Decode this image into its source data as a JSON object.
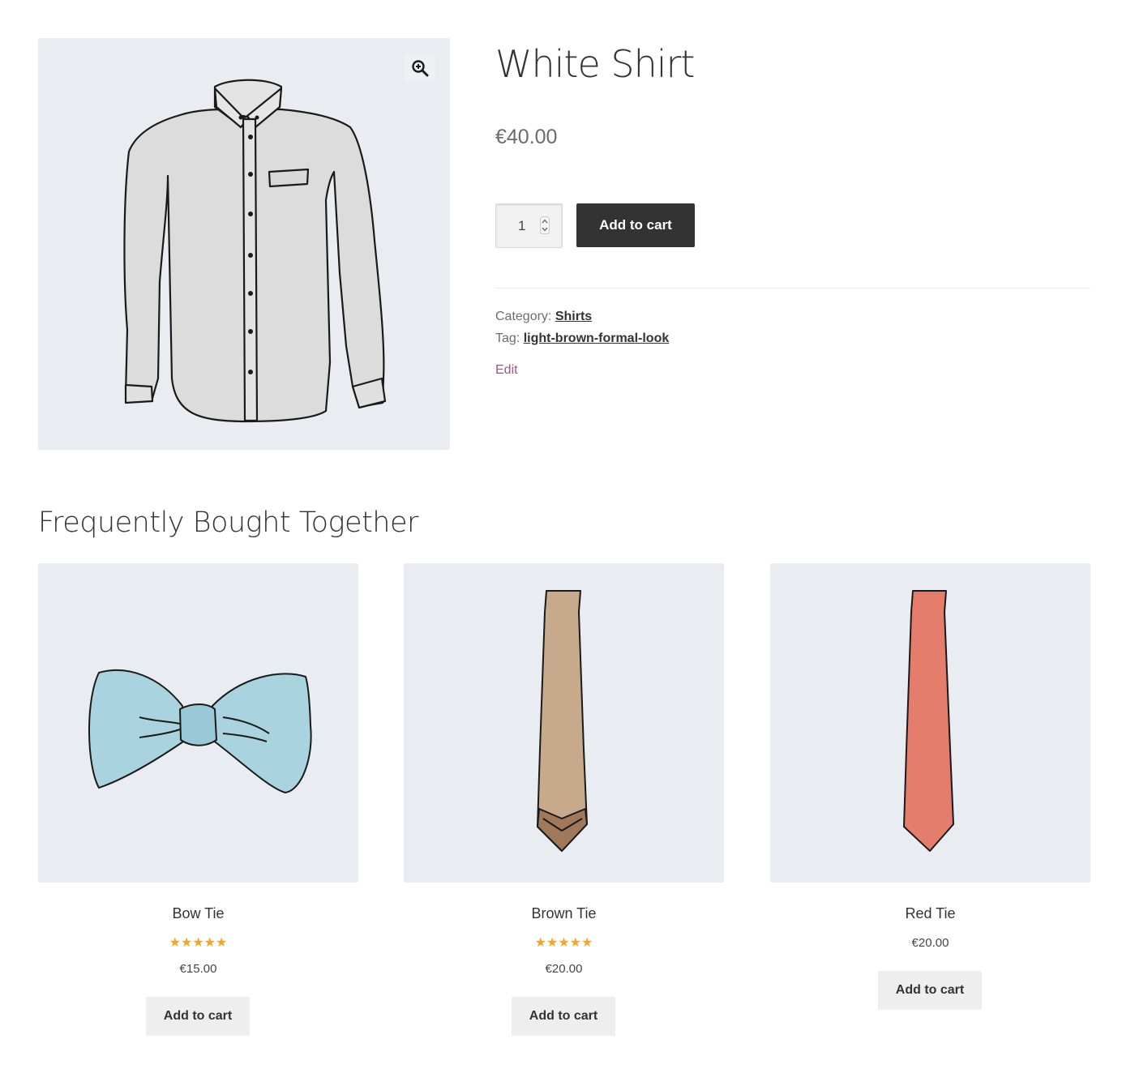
{
  "product": {
    "title": "White Shirt",
    "price": "€40.00",
    "quantity": "1",
    "add_to_cart_label": "Add to cart",
    "meta": {
      "category_label": "Category:",
      "category_value": "Shirts",
      "tag_label": "Tag:",
      "tag_value": "light-brown-formal-look"
    },
    "edit_label": "Edit",
    "image_icon": "shirt-illustration",
    "zoom_icon": "zoom-in-icon"
  },
  "related": {
    "heading": "Frequently Bought Together",
    "items": [
      {
        "title": "Bow Tie",
        "rating": 5,
        "stars": "★★★★★",
        "price": "€15.00",
        "button": "Add to cart",
        "color": "#a9d3df"
      },
      {
        "title": "Brown Tie",
        "rating": 5,
        "stars": "★★★★★",
        "price": "€20.00",
        "button": "Add to cart",
        "color": "#c7a98c"
      },
      {
        "title": "Red Tie",
        "price": "€20.00",
        "button": "Add to cart",
        "color": "#e57d6c"
      }
    ]
  },
  "colors": {
    "primary_button": "#333333",
    "secondary_button": "#eeeeee",
    "image_background": "#e9edf1",
    "star": "#f6a623",
    "edit_link": "#96588a"
  }
}
